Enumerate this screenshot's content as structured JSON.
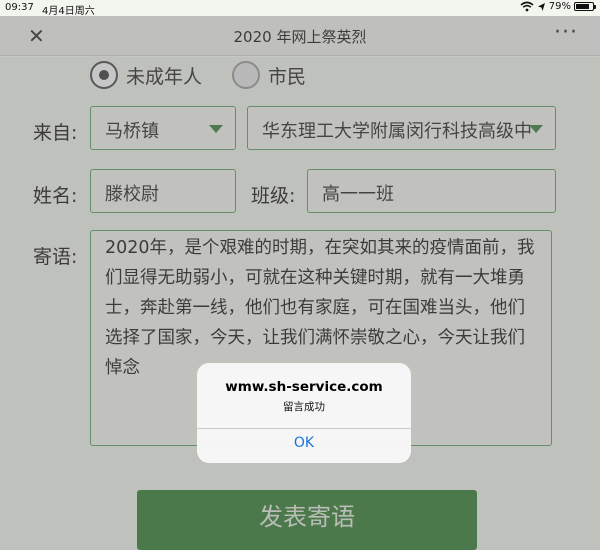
{
  "status_bar": {
    "time": "09:37",
    "date": "4月4日周六",
    "battery": "79%",
    "battery_level": 0.79
  },
  "nav": {
    "title": "2020 年网上祭英烈",
    "close_icon": "close-icon",
    "more_icon": "more-icon"
  },
  "form": {
    "radios": [
      {
        "label": "未成年人",
        "selected": true
      },
      {
        "label": "市民",
        "selected": false
      }
    ],
    "from_label": "来自:",
    "town": "马桥镇",
    "school": "华东理工大学附属闵行科技高级中",
    "name_label": "姓名:",
    "name_value": "滕校尉",
    "class_label": "班级:",
    "class_value": "高一一班",
    "message_label": "寄语:",
    "message": "2020年，是个艰难的时期，在突如其来的疫情面前，我们显得无助弱小，可就在这种关键时期，就有一大堆勇士，奔赴第一线，他们也有家庭，可在国难当头，他们选择了国家，今天，让我们满怀崇敬之心，今天让我们悼念",
    "submit_label": "发表寄语"
  },
  "alert": {
    "title": "wmw.sh-service.com",
    "message": "留言成功",
    "ok_label": "OK"
  }
}
